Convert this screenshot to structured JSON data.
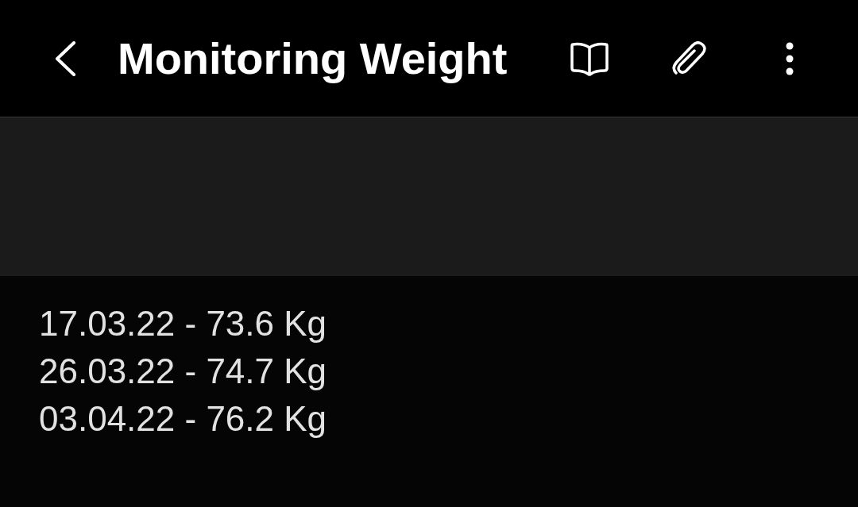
{
  "header": {
    "title": "Monitoring Weight"
  },
  "note": {
    "lines": [
      "17.03.22 - 73.6 Kg",
      "26.03.22 - 74.7 Kg",
      "03.04.22 - 76.2 Kg"
    ]
  }
}
